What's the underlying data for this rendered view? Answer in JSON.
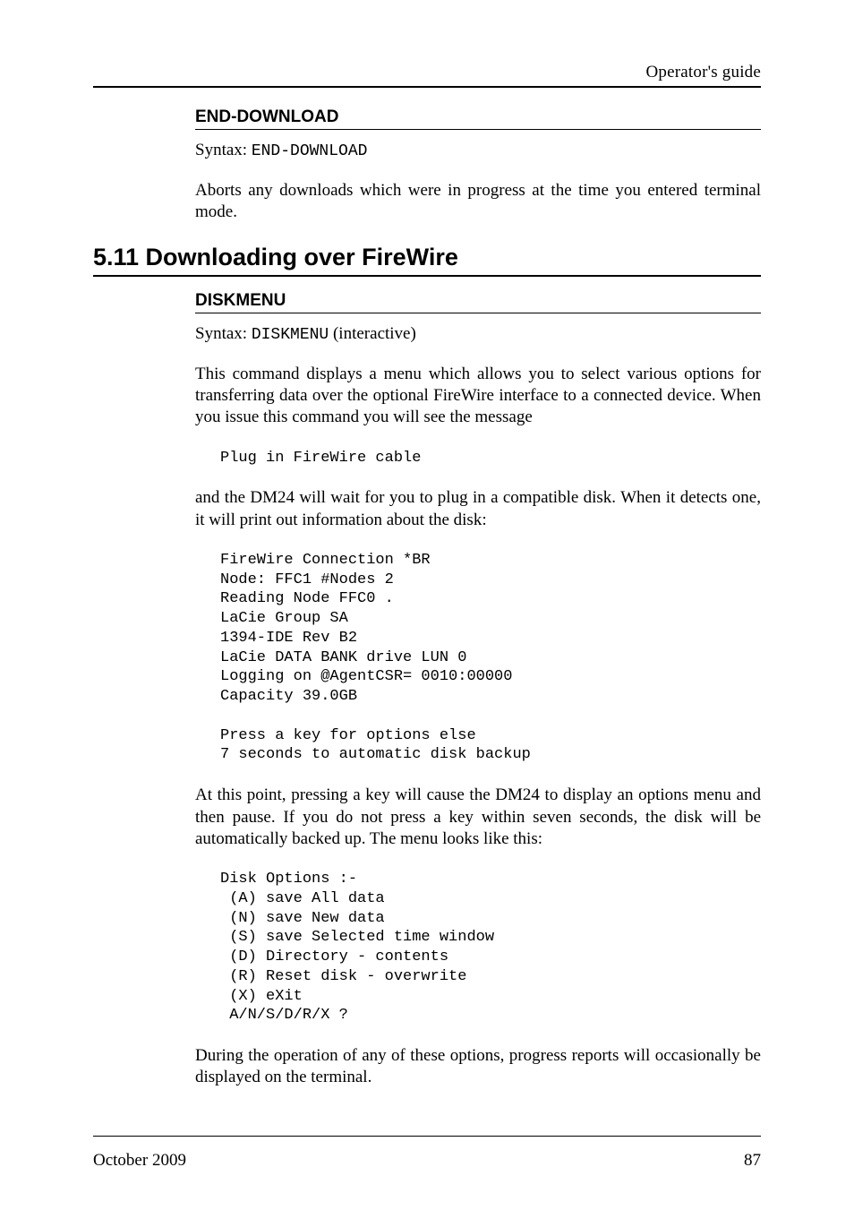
{
  "runhead": "Operator's guide",
  "sec_enddownload": {
    "heading": "END-DOWNLOAD",
    "syntax_label": "Syntax: ",
    "syntax_cmd": "END-DOWNLOAD",
    "para": "Aborts any downloads which were in progress at the time you entered terminal mode."
  },
  "sec_h2": "5.11 Downloading over FireWire",
  "sec_diskmenu": {
    "heading": "DISKMENU",
    "syntax_label": "Syntax: ",
    "syntax_cmd": "DISKMENU",
    "syntax_suffix": " (interactive)",
    "para1": "This command displays a menu which allows you to select various options for transferring data over the optional FireWire interface to a connected device. When you issue this command you will see the message",
    "code1": "Plug in FireWire cable",
    "para2": "and the DM24 will wait for you to plug in a compatible disk. When it detects one, it will print out information about the disk:",
    "code2": "FireWire Connection *BR\nNode: FFC1 #Nodes 2\nReading Node FFC0 .\nLaCie Group SA\n1394-IDE Rev B2\nLaCie DATA BANK drive LUN 0\nLogging on @AgentCSR= 0010:00000\nCapacity 39.0GB\n\nPress a key for options else\n7 seconds to automatic disk backup",
    "para3": "At this point, pressing a key will cause the DM24 to display an options menu and then pause. If you do not press a key within seven seconds, the disk will be automatically backed up.  The menu looks like this:",
    "code3": "Disk Options :-\n (A) save All data\n (N) save New data\n (S) save Selected time window\n (D) Directory - contents\n (R) Reset disk - overwrite\n (X) eXit\n A/N/S/D/R/X ?",
    "para4": "During the operation of any of these options, progress reports will occasionally be displayed on the terminal."
  },
  "footer": {
    "left": "October 2009",
    "right": "87"
  }
}
